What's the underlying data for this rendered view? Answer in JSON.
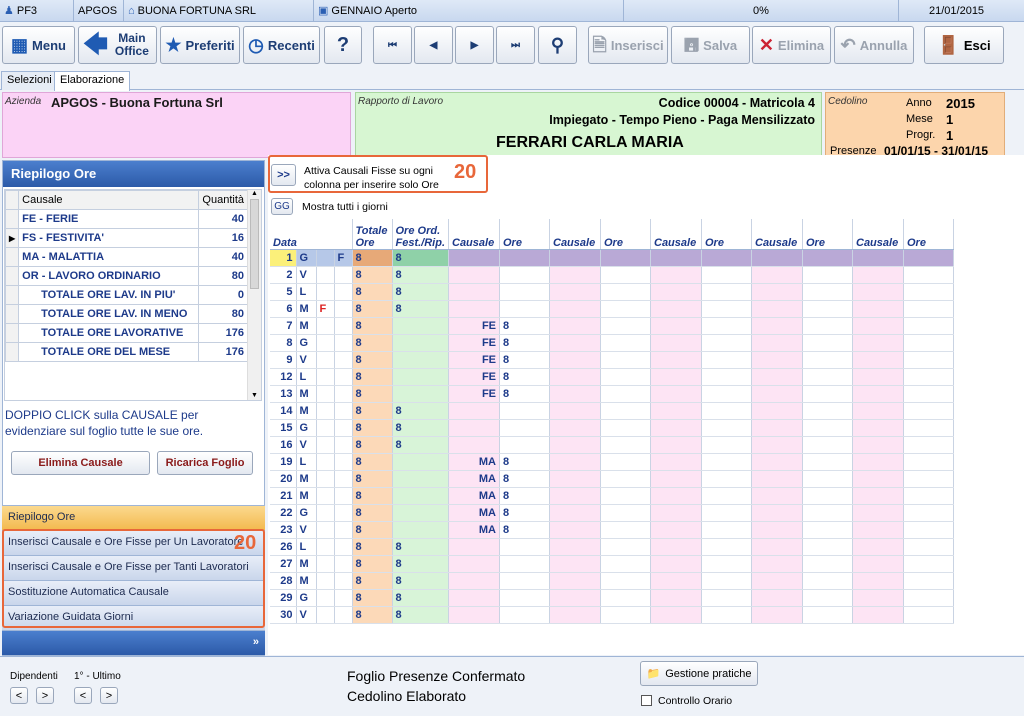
{
  "topbar": {
    "user": "PF3",
    "company_code": "APGOS",
    "company_name": "BUONA FORTUNA SRL",
    "period": "GENNAIO Aperto",
    "progress": "0%",
    "date": "21/01/2015"
  },
  "toolbar": {
    "menu": "Menu",
    "main_office": "Main Office",
    "preferiti": "Preferiti",
    "recenti": "Recenti",
    "help": "?",
    "inserisci": "Inserisci",
    "salva": "Salva",
    "elimina": "Elimina",
    "annulla": "Annulla",
    "esci": "Esci"
  },
  "tabs": [
    "Selezioni",
    "Elaborazione"
  ],
  "azienda": {
    "label": "Azienda",
    "value": "APGOS - Buona Fortuna Srl"
  },
  "rapporto": {
    "label": "Rapporto di Lavoro",
    "codice": "Codice 00004 - Matricola 4",
    "tipo": "Impiegato - Tempo Pieno - Paga Mensilizzato",
    "nome": "FERRARI CARLA MARIA"
  },
  "cedolino": {
    "label": "Cedolino",
    "anno_label": "Anno",
    "anno": "2015",
    "mese_label": "Mese",
    "mese": "1",
    "progr_label": "Progr.",
    "progr": "1",
    "presenze_label": "Presenze",
    "presenze": "01/01/15 - 31/01/15"
  },
  "riepilogo": {
    "title": "Riepilogo Ore",
    "col_causale": "Causale",
    "col_quantita": "Quantità",
    "rows": [
      {
        "c": "FE - FERIE",
        "q": "40"
      },
      {
        "c": "FS - FESTIVITA'",
        "q": "16"
      },
      {
        "c": "MA - MALATTIA",
        "q": "40"
      },
      {
        "c": "OR - LAVORO ORDINARIO",
        "q": "80"
      },
      {
        "c": "TOTALE ORE LAV. IN PIU'",
        "q": "0"
      },
      {
        "c": "TOTALE ORE LAV. IN MENO",
        "q": "80"
      },
      {
        "c": "TOTALE ORE LAVORATIVE",
        "q": "176"
      },
      {
        "c": "TOTALE ORE DEL MESE",
        "q": "176"
      }
    ],
    "hint": "DOPPIO CLICK sulla CAUSALE per evidenziare sul foglio tutte le sue ore.",
    "elimina": "Elimina Causale",
    "ricarica": "Ricarica Foglio"
  },
  "nav": [
    "Riepilogo Ore",
    "Inserisci Causale e Ore Fisse per Un Lavoratore",
    "Inserisci Causale e Ore Fisse per Tanti Lavoratori",
    "Sostituzione Automatica Causale",
    "Variazione Guidata Giorni"
  ],
  "callout_num": "20",
  "attiva": {
    "btn": ">>",
    "text": "Attiva Causali Fisse su ogni colonna per inserire solo Ore"
  },
  "mostra": {
    "btn": "GG",
    "text": "Mostra tutti i giorni"
  },
  "grid": {
    "h_data": "Data",
    "h_tot": "Totale Ore",
    "h_ord": "Ore Ord. Fest./Rip.",
    "h_causale": "Causale",
    "h_ore": "Ore",
    "rows": [
      {
        "d": "1",
        "g": "G",
        "f": "F",
        "fc": "",
        "t": "8",
        "o": "8",
        "c": "",
        "h": ""
      },
      {
        "d": "2",
        "g": "V",
        "f": "",
        "fc": "",
        "t": "8",
        "o": "8",
        "c": "",
        "h": ""
      },
      {
        "d": "5",
        "g": "L",
        "f": "",
        "fc": "",
        "t": "8",
        "o": "8",
        "c": "",
        "h": ""
      },
      {
        "d": "6",
        "g": "M",
        "f": "",
        "fc": "F",
        "t": "8",
        "o": "8",
        "c": "",
        "h": ""
      },
      {
        "d": "7",
        "g": "M",
        "f": "",
        "fc": "",
        "t": "8",
        "o": "",
        "c": "FE",
        "h": "8"
      },
      {
        "d": "8",
        "g": "G",
        "f": "",
        "fc": "",
        "t": "8",
        "o": "",
        "c": "FE",
        "h": "8"
      },
      {
        "d": "9",
        "g": "V",
        "f": "",
        "fc": "",
        "t": "8",
        "o": "",
        "c": "FE",
        "h": "8"
      },
      {
        "d": "12",
        "g": "L",
        "f": "",
        "fc": "",
        "t": "8",
        "o": "",
        "c": "FE",
        "h": "8"
      },
      {
        "d": "13",
        "g": "M",
        "f": "",
        "fc": "",
        "t": "8",
        "o": "",
        "c": "FE",
        "h": "8"
      },
      {
        "d": "14",
        "g": "M",
        "f": "",
        "fc": "",
        "t": "8",
        "o": "8",
        "c": "",
        "h": ""
      },
      {
        "d": "15",
        "g": "G",
        "f": "",
        "fc": "",
        "t": "8",
        "o": "8",
        "c": "",
        "h": ""
      },
      {
        "d": "16",
        "g": "V",
        "f": "",
        "fc": "",
        "t": "8",
        "o": "8",
        "c": "",
        "h": ""
      },
      {
        "d": "19",
        "g": "L",
        "f": "",
        "fc": "",
        "t": "8",
        "o": "",
        "c": "MA",
        "h": "8"
      },
      {
        "d": "20",
        "g": "M",
        "f": "",
        "fc": "",
        "t": "8",
        "o": "",
        "c": "MA",
        "h": "8"
      },
      {
        "d": "21",
        "g": "M",
        "f": "",
        "fc": "",
        "t": "8",
        "o": "",
        "c": "MA",
        "h": "8"
      },
      {
        "d": "22",
        "g": "G",
        "f": "",
        "fc": "",
        "t": "8",
        "o": "",
        "c": "MA",
        "h": "8"
      },
      {
        "d": "23",
        "g": "V",
        "f": "",
        "fc": "",
        "t": "8",
        "o": "",
        "c": "MA",
        "h": "8"
      },
      {
        "d": "26",
        "g": "L",
        "f": "",
        "fc": "",
        "t": "8",
        "o": "8",
        "c": "",
        "h": ""
      },
      {
        "d": "27",
        "g": "M",
        "f": "",
        "fc": "",
        "t": "8",
        "o": "8",
        "c": "",
        "h": ""
      },
      {
        "d": "28",
        "g": "M",
        "f": "",
        "fc": "",
        "t": "8",
        "o": "8",
        "c": "",
        "h": ""
      },
      {
        "d": "29",
        "g": "G",
        "f": "",
        "fc": "",
        "t": "8",
        "o": "8",
        "c": "",
        "h": ""
      },
      {
        "d": "30",
        "g": "V",
        "f": "",
        "fc": "",
        "t": "8",
        "o": "8",
        "c": "",
        "h": ""
      }
    ]
  },
  "footer": {
    "dipendenti": "Dipendenti",
    "range": "1° - Ultimo",
    "prev": "<",
    "next": ">",
    "status1": "Foglio Presenze Confermato",
    "status2": "Cedolino Elaborato",
    "gestione": "Gestione pratiche",
    "controllo": "Controllo Orario"
  }
}
